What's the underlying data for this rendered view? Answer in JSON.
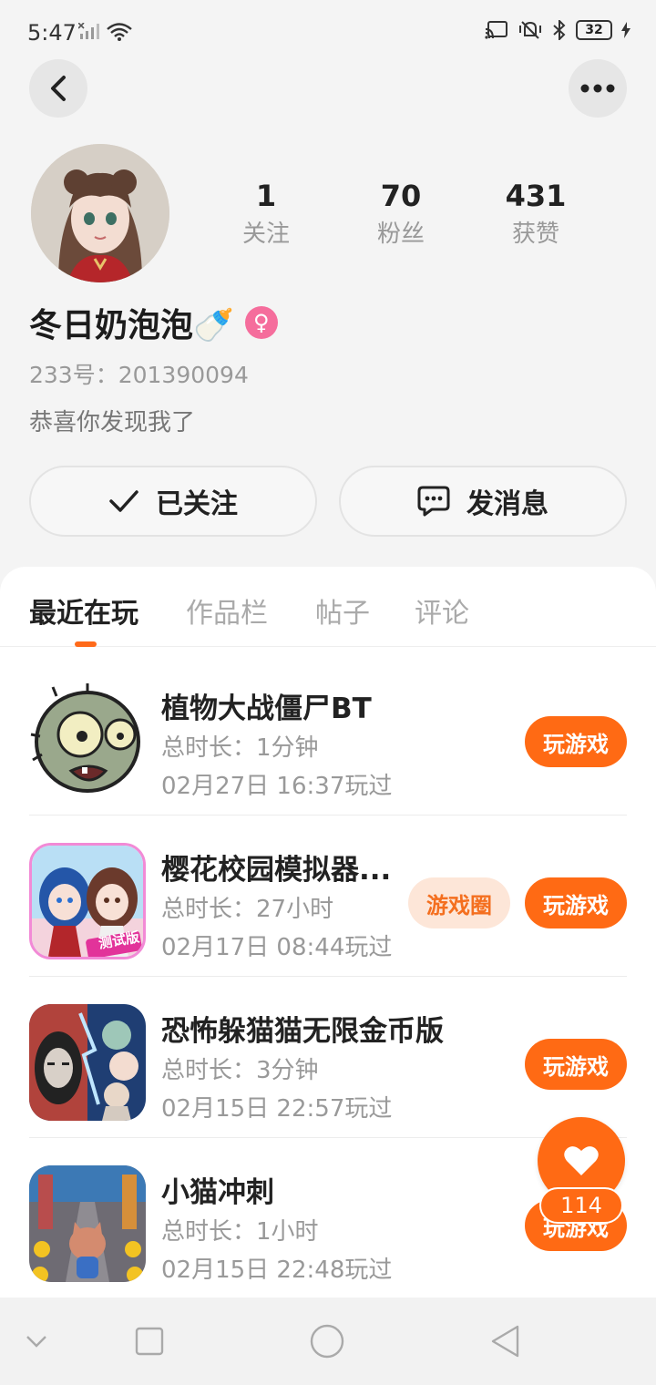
{
  "status_bar": {
    "time": "5:47",
    "battery": "32"
  },
  "profile": {
    "stats": [
      {
        "num": "1",
        "label": "关注"
      },
      {
        "num": "70",
        "label": "粉丝"
      },
      {
        "num": "431",
        "label": "获赞"
      }
    ],
    "nickname": "冬日奶泡泡🍼",
    "gender_symbol": "♀",
    "user_id": "233号：201390094",
    "bio": "恭喜你发现我了",
    "follow_label": "已关注",
    "message_label": "发消息"
  },
  "tabs": [
    "最近在玩",
    "作品栏",
    "帖子",
    "评论"
  ],
  "games": [
    {
      "title": "植物大战僵尸BT",
      "duration": "总时长：1分钟",
      "played": "02月27日 16:37玩过",
      "play_label": "玩游戏"
    },
    {
      "title": "樱花校园模拟器...",
      "duration": "总时长：27小时",
      "played": "02月17日 08:44玩过",
      "play_label": "玩游戏",
      "circle_label": "游戏圈",
      "icon_badge": "测试版"
    },
    {
      "title": "恐怖躲猫猫无限金币版",
      "duration": "总时长：3分钟",
      "played": "02月15日 22:57玩过",
      "play_label": "玩游戏"
    },
    {
      "title": "小猫冲刺",
      "duration": "总时长：1小时",
      "played": "02月15日 22:48玩过",
      "play_label": "玩游戏"
    }
  ],
  "like": {
    "count": "114"
  },
  "colors": {
    "accent": "#ff6a14",
    "badge_bg": "#fde6d8",
    "gender": "#f56d9c"
  }
}
